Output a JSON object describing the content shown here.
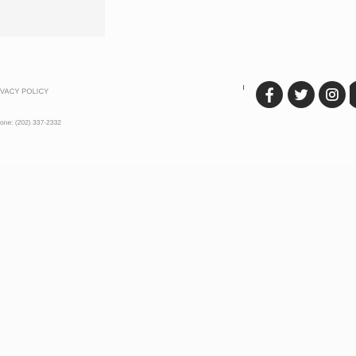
{
  "footer": {
    "privacy_label": "VACY POLICY",
    "phone_text": "one: (202) 337-2332",
    "social_icons": [
      "facebook-icon",
      "twitter-icon",
      "instagram-icon",
      "vimeo-icon"
    ],
    "icon_color": "#2b2b2b"
  }
}
